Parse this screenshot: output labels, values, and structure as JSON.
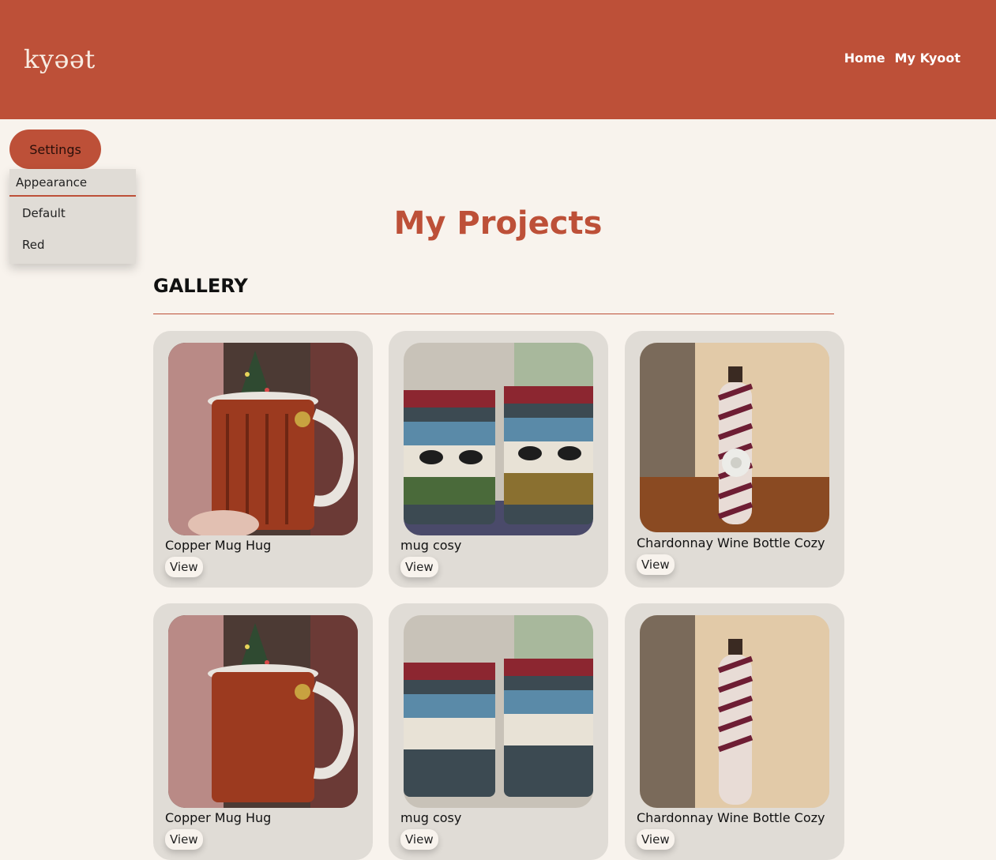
{
  "header": {
    "logo": "kyəət",
    "nav": [
      {
        "label": "Home"
      },
      {
        "label": "My Kyoot"
      }
    ],
    "color": "#bd5038"
  },
  "settings": {
    "button_label": "Settings",
    "menu": {
      "heading": "Appearance",
      "items": [
        {
          "label": "Default"
        },
        {
          "label": "Red"
        }
      ]
    }
  },
  "main": {
    "title": "My Projects",
    "section": "GALLERY",
    "cards": [
      {
        "title": "Copper Mug Hug",
        "action": "View"
      },
      {
        "title": "mug cosy",
        "action": "View"
      },
      {
        "title": "Chardonnay Wine Bottle Cozy",
        "action": "View"
      },
      {
        "title": "Copper Mug Hug",
        "action": "View"
      },
      {
        "title": "mug cosy",
        "action": "View"
      },
      {
        "title": "Chardonnay Wine Bottle Cozy",
        "action": "View"
      }
    ]
  },
  "colors": {
    "accent": "#bd5038",
    "background": "#f8f3ed",
    "card": "#e0dcd6"
  }
}
